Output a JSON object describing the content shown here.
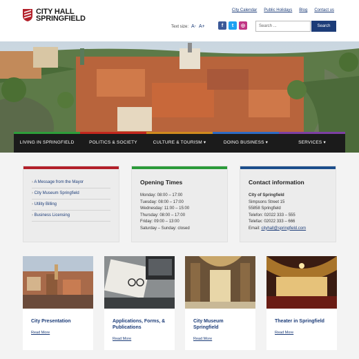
{
  "site": {
    "logo_line1": "CITY HALL",
    "logo_line2": "SPRINGFIELD"
  },
  "top_links": [
    "City Calendar",
    "Public Holidays",
    "Blog",
    "Contact us"
  ],
  "text_size": {
    "label": "Text size:",
    "decrease": "A-",
    "increase": "A+"
  },
  "social": [
    "facebook-icon",
    "twitter-icon",
    "instagram-icon"
  ],
  "search": {
    "placeholder": "Search ...",
    "button": "Search"
  },
  "nav": [
    {
      "label": "LIVING IN SPRINGFIELD",
      "color": "#2e9e3a"
    },
    {
      "label": "POLITICS & SOCIETY",
      "color": "#c4261d"
    },
    {
      "label": "CULTURE & TOURISM ▾",
      "color": "#d08b1e"
    },
    {
      "label": "DOING BUSINESS ▾",
      "color": "#2d6bc4"
    },
    {
      "label": "SERVICES ▾",
      "color": "#7d3fa3"
    }
  ],
  "quicklinks": {
    "color": "#b3202a",
    "items": [
      "A Message from the Mayor",
      "City Museum Springfield",
      "Utility Billing",
      "Business Licensing"
    ]
  },
  "opening": {
    "color": "#2b9b3a",
    "title": "Opening Times",
    "lines": [
      "Monday: 08:00 – 17:00",
      "Tuesday: 08:00 – 17:00",
      "Wednesday: 11:00 – 15:00",
      "Thursday: 08:00 – 17:00",
      "Friday: 09:00 – 13:00",
      "Saturday – Sunday: closed"
    ]
  },
  "contact": {
    "color": "#1c4e8c",
    "title": "Contact information",
    "name": "City of Springfield",
    "street": "Simpsons Street 15",
    "city": "55858 Springfield",
    "phone": "Telefon: 02022 333 – 555",
    "fax": "Telefax: 02022 333 – 666",
    "email_label": "Email:",
    "email": "cityhall@springfield.com"
  },
  "cards": [
    {
      "title": "City Presentation",
      "more": "Read More"
    },
    {
      "title": "Applications, Forms, & Publications",
      "more": "Read More"
    },
    {
      "title": "City Museum Springfield",
      "more": "Read More"
    },
    {
      "title": "Theater in Springfield",
      "more": "Read More"
    }
  ]
}
